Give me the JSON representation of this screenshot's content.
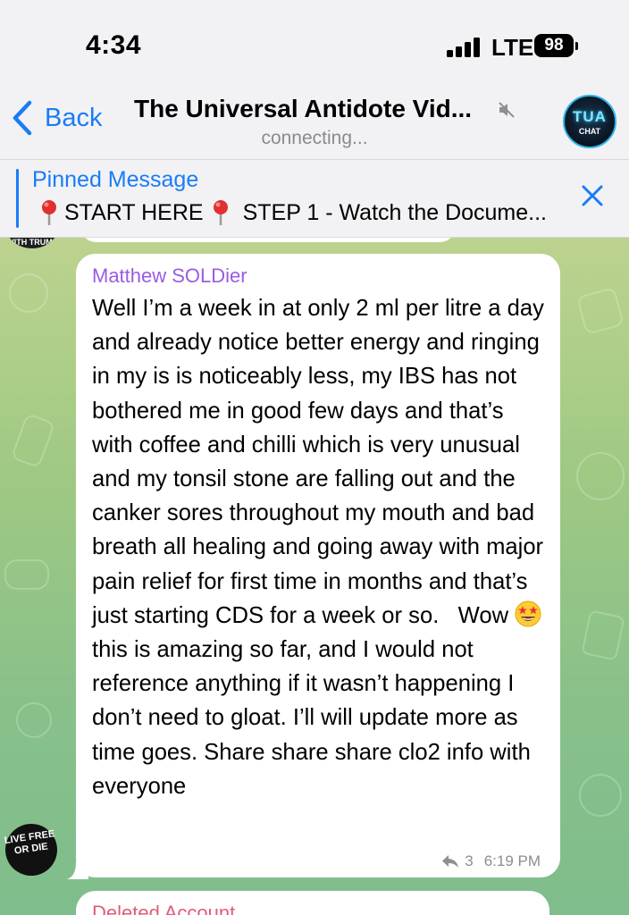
{
  "status_bar": {
    "time": "4:34",
    "network": "LTE",
    "battery": "98"
  },
  "header": {
    "back_label": "Back",
    "title": "The Universal Antidote Vid...",
    "subtitle": "connecting...",
    "avatar_text_main": "TUA",
    "avatar_text_sub": "CHAT",
    "accent_color": "#1a7cf5"
  },
  "pinned": {
    "label": "Pinned Message",
    "text_start": "START HERE",
    "text_rest": "STEP 1 - Watch the Docume..."
  },
  "messages": [
    {
      "sender": "Matthew SOLDier",
      "sender_color": "#9a5ce0",
      "text_before_emoji": "Well I’m a week in at only 2 ml per litre a day and already notice better energy and ringing in my is is noticeably less, my IBS has not bothered me in good few days and that’s with coffee and chilli which is very unusual and my tonsil stone are falling out and the canker sores throughout my mouth and bad breath all healing and going away with major pain relief for first time in months and that’s just starting CDS for a week or so.   Wow ",
      "emoji": "star-struck-emoji",
      "text_after_emoji": " this is amazing so far, and I would not reference anything if it wasn’t happening I don’t need to gloat. I’ll will update more as time goes. Share share share clo2 info with everyone",
      "reply_count": "3",
      "time": "6:19 PM",
      "avatar_text": "LIVE FREE OR DIE"
    },
    {
      "sender": "Deleted Account",
      "sender_color": "#e05c7a"
    }
  ],
  "previous_avatar_text": "WITH TRUMP"
}
